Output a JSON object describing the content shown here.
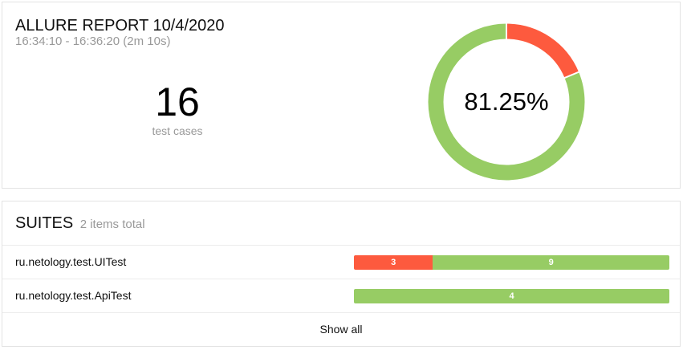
{
  "summary": {
    "title": "ALLURE REPORT 10/4/2020",
    "time_range": "16:34:10 - 16:36:20 (2m 10s)",
    "test_count": "16",
    "test_count_caption": "test cases",
    "success_rate": "81.25%",
    "donut": {
      "passed": 13,
      "failed": 3,
      "passed_color": "#97cc64",
      "failed_color": "#fd5a3e"
    }
  },
  "suites": {
    "title": "SUITES",
    "count_text": "2 items total",
    "items": [
      {
        "name": "ru.netology.test.UITest",
        "failed": 3,
        "passed": 9,
        "failed_label": "3",
        "passed_label": "9"
      },
      {
        "name": "ru.netology.test.ApiTest",
        "failed": 0,
        "passed": 4,
        "failed_label": "",
        "passed_label": "4"
      }
    ],
    "show_all_label": "Show all"
  },
  "colors": {
    "failed": "#fd5a3e",
    "passed": "#97cc64"
  }
}
